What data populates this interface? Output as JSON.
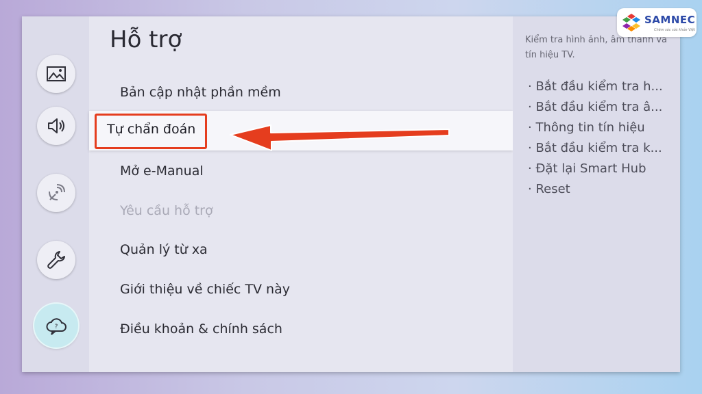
{
  "screen": {
    "title": "Hỗ trợ",
    "sidebar": {
      "items": [
        {
          "icon": "picture-icon"
        },
        {
          "icon": "sound-icon"
        },
        {
          "icon": "broadcast-icon"
        },
        {
          "icon": "wrench-icon"
        },
        {
          "icon": "support-cloud-icon",
          "active": true
        }
      ]
    },
    "menu": {
      "items": [
        {
          "label": "Bản cập nhật phần mềm"
        },
        {
          "label": "Tự chẩn đoán",
          "selected": true
        },
        {
          "label": "Mở e-Manual"
        },
        {
          "label": "Yêu cầu hỗ trợ",
          "disabled": true
        },
        {
          "label": "Quản lý từ xa",
          "toggle": "off"
        },
        {
          "label": "Giới thiệu về chiếc TV này"
        },
        {
          "label": "Điều khoản & chính sách"
        }
      ]
    },
    "description": {
      "text": "Kiểm tra hình ảnh, âm thanh và tín hiệu TV.",
      "items": [
        "· Bắt đầu kiểm tra h...",
        "· Bắt đầu kiểm tra â...",
        "· Thông tin tín hiệu",
        "· Bắt đầu kiểm tra k...",
        "· Đặt lại Smart Hub",
        "· Reset"
      ]
    }
  },
  "annotation": {
    "color": "#e53d1e"
  },
  "watermark": {
    "brand": "SAMNEC",
    "tagline": "Chăm sóc sức khỏe Việt"
  }
}
